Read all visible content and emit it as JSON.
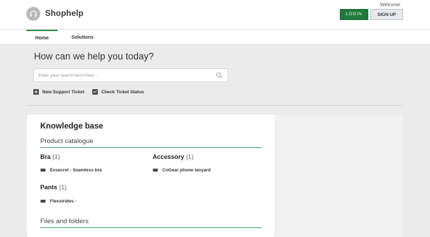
{
  "header": {
    "brand": "Shophelp",
    "welcome": "Welcome",
    "login_label": "LOGIN",
    "signup_label": "SIGN UP"
  },
  "nav": {
    "tabs": [
      {
        "label": "Home"
      },
      {
        "label": "Solutions"
      }
    ]
  },
  "hero": {
    "title": "How can we help you today?",
    "search_placeholder": "Enter your search term here...",
    "search_value": "",
    "actions": [
      {
        "label": "New Support Ticket",
        "icon": "plus-icon"
      },
      {
        "label": "Check Ticket Status",
        "icon": "chart-icon"
      }
    ]
  },
  "kb": {
    "title": "Knowledge base",
    "sections": [
      {
        "title": "Product catalogue",
        "categories": [
          {
            "name": "Bra",
            "count": "(1)",
            "articles": [
              "Exsecret - Seamless bra"
            ]
          },
          {
            "name": "Accessory",
            "count": "(1)",
            "articles": [
              "CoGear phone lanyard"
            ]
          },
          {
            "name": "Pants",
            "count": "(1)",
            "articles": [
              "Flexstrides -"
            ]
          }
        ]
      },
      {
        "title": "Files and folders",
        "categories": []
      }
    ]
  },
  "colors": {
    "accent": "#2e8b4e",
    "login_bg": "#1f7a3c",
    "page_bg": "#ebebeb"
  }
}
